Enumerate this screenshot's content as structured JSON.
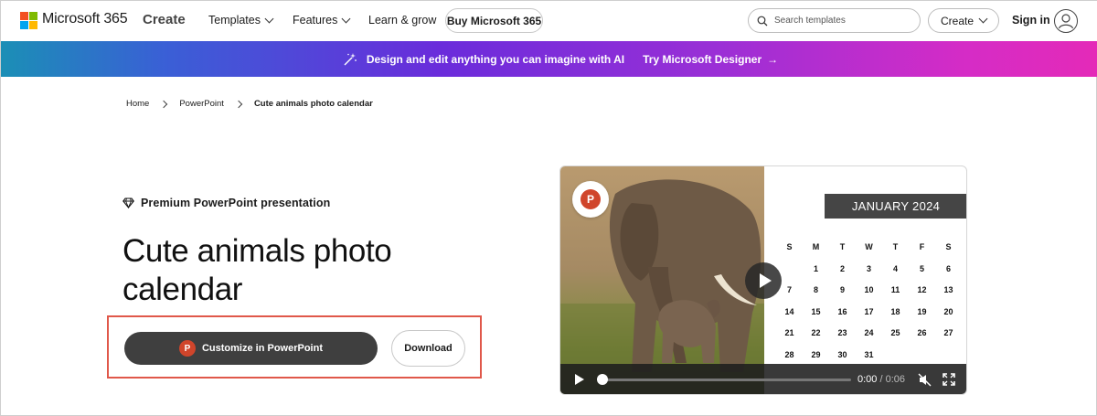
{
  "nav": {
    "brand": "Microsoft 365",
    "create": "Create",
    "templates": "Templates",
    "features": "Features",
    "learn": "Learn & grow",
    "buy": "Buy Microsoft 365",
    "search_placeholder": "Search templates",
    "create_menu": "Create",
    "signin": "Sign in"
  },
  "banner": {
    "text": "Design and edit anything you can imagine with AI",
    "link": "Try Microsoft Designer",
    "link_arrow": "→"
  },
  "breadcrumb": {
    "items": [
      "Home",
      "PowerPoint",
      "Cute animals photo calendar"
    ]
  },
  "template": {
    "badge": "Premium PowerPoint presentation",
    "title": "Cute animals photo calendar",
    "customize_label": "Customize in PowerPoint",
    "download_label": "Download",
    "app_letter": "P"
  },
  "calendar": {
    "month": "JANUARY 2024",
    "weekdays": [
      "S",
      "M",
      "T",
      "W",
      "T",
      "F",
      "S"
    ],
    "weeks": [
      [
        "",
        "1",
        "2",
        "3",
        "4",
        "5",
        "6"
      ],
      [
        "7",
        "8",
        "9",
        "10",
        "11",
        "12",
        "13"
      ],
      [
        "14",
        "15",
        "16",
        "17",
        "18",
        "19",
        "20"
      ],
      [
        "21",
        "22",
        "23",
        "24",
        "25",
        "26",
        "27"
      ],
      [
        "28",
        "29",
        "30",
        "31",
        "",
        "",
        ""
      ]
    ]
  },
  "video": {
    "current_time": "0:00",
    "separator": " / ",
    "duration": "0:06",
    "progress_fraction": 0.0
  },
  "colors": {
    "ms_red": "#f25022",
    "ms_green": "#7fba00",
    "ms_blue": "#00a4ef",
    "ms_yellow": "#ffb900",
    "powerpoint": "#d0452b",
    "highlight": "#e0584a"
  }
}
